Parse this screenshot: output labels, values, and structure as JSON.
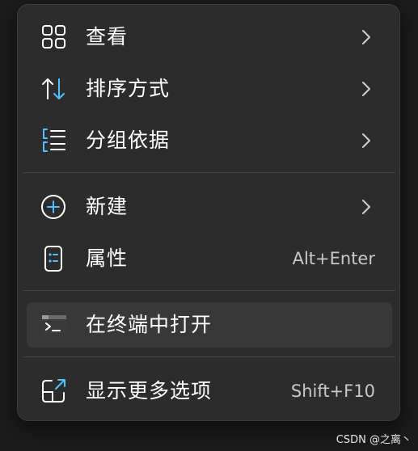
{
  "context_menu": {
    "items": [
      {
        "label": "查看",
        "icon": "grid-view-icon",
        "submenu": true
      },
      {
        "label": "排序方式",
        "icon": "sort-arrows-icon",
        "submenu": true
      },
      {
        "label": "分组依据",
        "icon": "group-list-icon",
        "submenu": true
      },
      {
        "label": "新建",
        "icon": "plus-circle-icon",
        "submenu": true
      },
      {
        "label": "属性",
        "icon": "properties-icon",
        "shortcut": "Alt+Enter"
      },
      {
        "label": "在终端中打开",
        "icon": "terminal-icon",
        "highlighted": true
      },
      {
        "label": "显示更多选项",
        "icon": "more-options-icon",
        "shortcut": "Shift+F10"
      }
    ]
  },
  "colors": {
    "menu_background": "#2c2c2c",
    "hover_background": "#383838",
    "accent_blue": "#4cc2ff",
    "text": "#ffffff"
  },
  "watermark": "CSDN @之离丶"
}
